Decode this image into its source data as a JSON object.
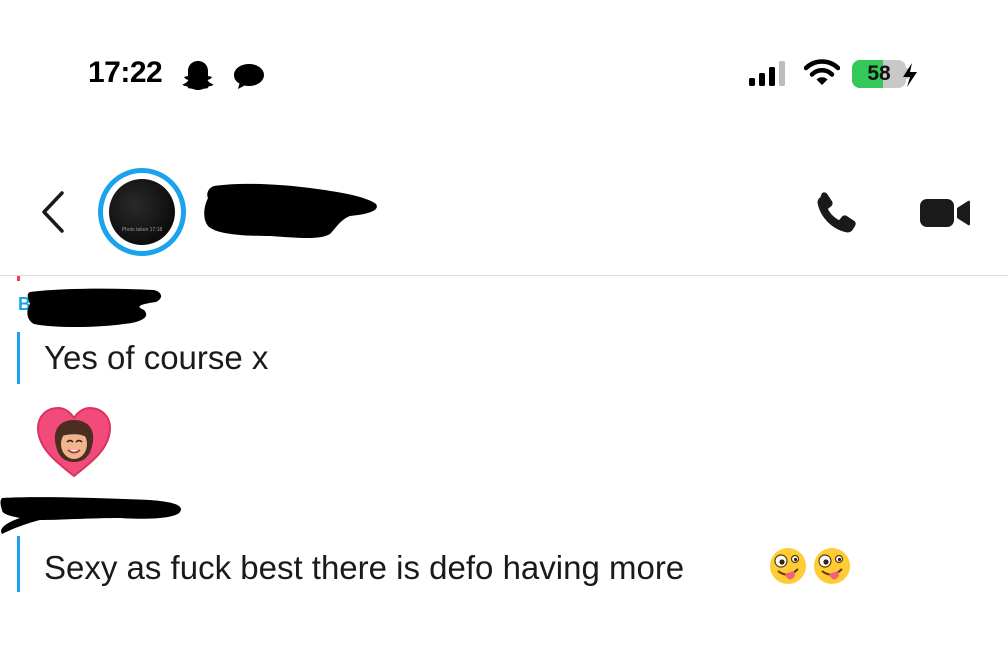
{
  "status_bar": {
    "time": "17:22",
    "battery_level": "58",
    "battery_fraction": 0.58,
    "icons": [
      "ghost-icon",
      "chat-bubble-icon",
      "signal-icon",
      "wifi-icon",
      "charging-bolt-icon"
    ]
  },
  "header": {
    "back_icon": "chevron-left-icon",
    "avatar_caption": "Photo taken 17:18",
    "call_icon": "phone-icon",
    "video_icon": "video-camera-icon",
    "accent_color": "#1aa3ec"
  },
  "messages": [
    {
      "sender_initial": "B",
      "text": "Yes of course x",
      "sender_color": "#1aa3ec"
    },
    {
      "sticker": "bitmoji-heart",
      "text": "Sexy as fuck best there is defo having more",
      "emojis": "🤪🤪"
    }
  ],
  "colors": {
    "accent_blue": "#1aa3ec",
    "battery_green": "#34c759",
    "redaction": "#000000"
  }
}
